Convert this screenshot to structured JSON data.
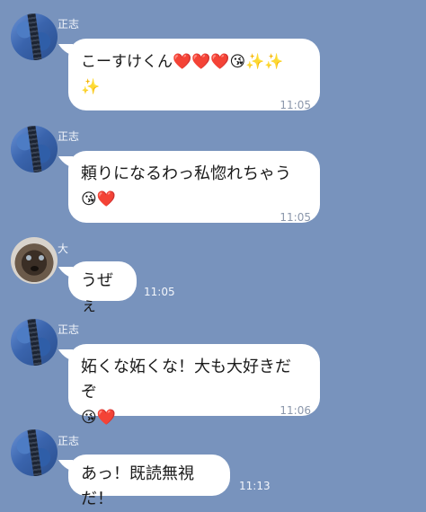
{
  "messages": [
    {
      "sender": "正志",
      "line1": "こーすけくん❤️❤️❤️😘✨✨",
      "line2": "✨",
      "time": "11:05"
    },
    {
      "sender": "正志",
      "line1": "頼りになるわっ私惚れちゃう",
      "line2": "😘❤️",
      "time": "11:05"
    },
    {
      "sender": "大",
      "line1": "うぜぇ",
      "time": "11:05"
    },
    {
      "sender": "正志",
      "line1": "妬くな妬くな！大も大好きだぞ",
      "line2": "😘❤️",
      "time": "11:06"
    },
    {
      "sender": "正志",
      "line1": "あっ！既読無視だ！",
      "time": "11:13"
    }
  ]
}
